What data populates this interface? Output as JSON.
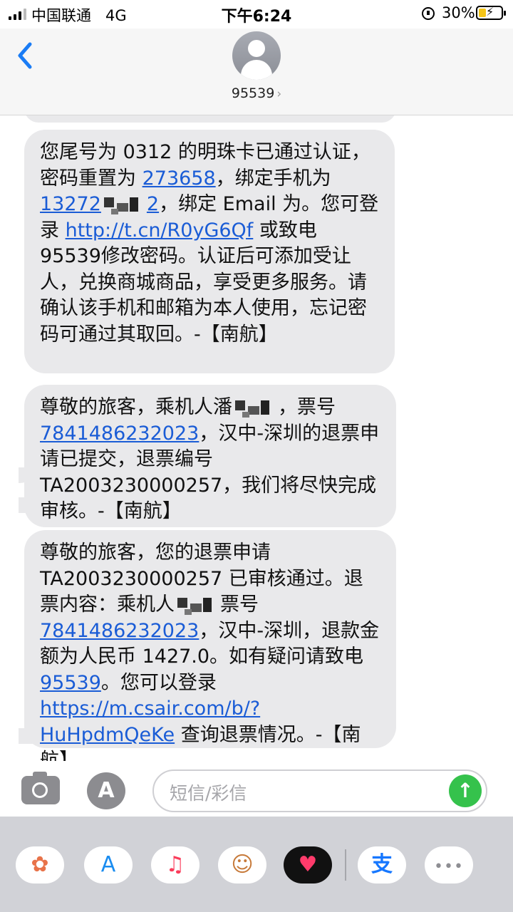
{
  "status_bar": {
    "carrier": "中国联通",
    "network": "4G",
    "time": "下午6:24",
    "battery_percent": "30%",
    "battery_level": 0.3,
    "charging": true
  },
  "header": {
    "back_icon": "chevron-left-icon",
    "avatar_icon": "person-icon",
    "contact": "95539",
    "contact_chevron": "›"
  },
  "messages": [
    {
      "parts": [
        {
          "t": "您尾号为 0312 的明珠卡已通过认证，密码重置为 "
        },
        {
          "t": "273658",
          "link": true
        },
        {
          "t": "，绑定手机为 "
        },
        {
          "t": "13272",
          "link": true
        },
        {
          "redacted": true
        },
        {
          "t": "2",
          "link": true
        },
        {
          "t": "，绑定 Email 为。您可登录 "
        },
        {
          "t": "http://t.cn/R0yG6Qf",
          "link": true
        },
        {
          "t": " 或致电 "
        },
        {
          "t": "95539",
          "link": false
        },
        {
          "t": "修改密码。认证后可添加受让人，兑换商城商品，享受更多服务。请确认该手机和邮箱为本人使用，忘记密码可通过其取回。-【南航】"
        }
      ]
    },
    {
      "parts": [
        {
          "t": "尊敬的旅客，乘机人潘"
        },
        {
          "redacted": true
        },
        {
          "t": "，票号 "
        },
        {
          "t": "7841486232023",
          "link": true
        },
        {
          "t": "，汉中-深圳的退票申请已提交，退票编号 TA2003230000257，我们将尽快完成审核。-【南航】"
        }
      ]
    },
    {
      "parts": [
        {
          "t": "尊敬的旅客，您的退票申请 TA2003230000257 已审核通过。退票内容：乘机人"
        },
        {
          "redacted": true
        },
        {
          "t": "票号 "
        },
        {
          "t": "7841486232023",
          "link": true
        },
        {
          "t": "，汉中-深圳，退款金额为人民币 1427.0。如有疑问请致电 "
        },
        {
          "t": "95539",
          "link": true
        },
        {
          "t": "。您可以登录 "
        },
        {
          "t": "https://m.csair.com/b/?HuHpdmQeKe",
          "link": true
        },
        {
          "t": " 查询退票情况。-【南航】"
        }
      ]
    }
  ],
  "input": {
    "camera_icon": "camera-icon",
    "apps_icon": "app-store-icon",
    "placeholder": "短信/彩信",
    "send_icon": "arrow-up-icon"
  },
  "app_strip": [
    {
      "name": "photos",
      "icon": "photos-icon",
      "glyph": "✿",
      "color": "#e8734a"
    },
    {
      "name": "app-store",
      "icon": "app-store-icon",
      "glyph": "A",
      "color": "#1a8cf0"
    },
    {
      "name": "music",
      "icon": "music-icon",
      "glyph": "♫",
      "color": "#fa3c5a"
    },
    {
      "name": "memoji",
      "icon": "memoji-icon",
      "glyph": "☺",
      "color": "#c77a3a"
    },
    {
      "name": "digital-touch",
      "icon": "heart-icon",
      "glyph": "♥",
      "color": "#ff3b6b"
    },
    {
      "name": "alipay",
      "icon": "alipay-icon",
      "glyph": "支",
      "color": "#1677ff"
    },
    {
      "name": "more",
      "icon": "more-icon",
      "glyph": "•••",
      "color": "#8e8e93"
    }
  ],
  "colors": {
    "accent": "#1a7cf5",
    "bubble": "#e9e9eb",
    "link": "#1a5cd6",
    "send": "#35c24c"
  }
}
